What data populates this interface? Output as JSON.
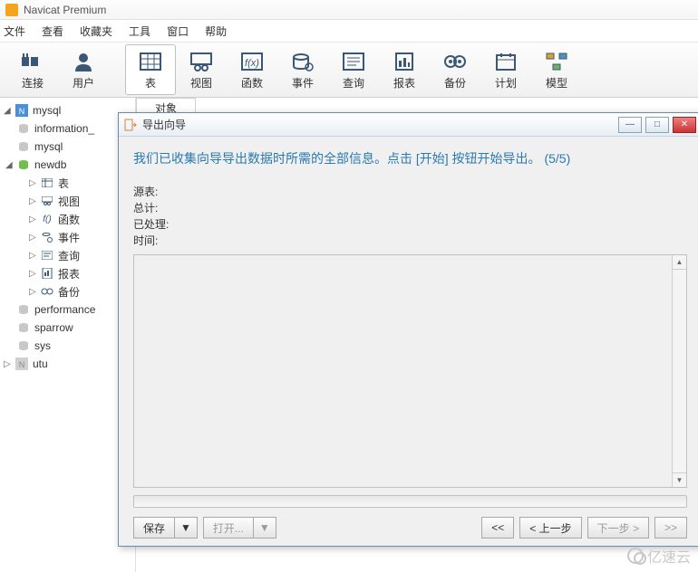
{
  "app": {
    "title": "Navicat Premium"
  },
  "menu": [
    "文件",
    "查看",
    "收藏夹",
    "工具",
    "窗口",
    "帮助"
  ],
  "toolbar": [
    {
      "label": "连接",
      "icon": "plug"
    },
    {
      "label": "用户",
      "icon": "user"
    },
    {
      "label": "表",
      "icon": "table",
      "active": true
    },
    {
      "label": "视图",
      "icon": "view"
    },
    {
      "label": "函数",
      "icon": "fx"
    },
    {
      "label": "事件",
      "icon": "event"
    },
    {
      "label": "查询",
      "icon": "query"
    },
    {
      "label": "报表",
      "icon": "report"
    },
    {
      "label": "备份",
      "icon": "backup"
    },
    {
      "label": "计划",
      "icon": "schedule"
    },
    {
      "label": "模型",
      "icon": "model"
    }
  ],
  "tree": {
    "root": "mysql",
    "children": [
      {
        "label": "information_",
        "type": "db"
      },
      {
        "label": "mysql",
        "type": "db"
      },
      {
        "label": "newdb",
        "type": "db",
        "expanded": true,
        "children": [
          {
            "label": "表",
            "icon": "table"
          },
          {
            "label": "视图",
            "icon": "view"
          },
          {
            "label": "函数",
            "icon": "fx"
          },
          {
            "label": "事件",
            "icon": "event"
          },
          {
            "label": "查询",
            "icon": "query"
          },
          {
            "label": "报表",
            "icon": "report"
          },
          {
            "label": "备份",
            "icon": "backup"
          }
        ]
      },
      {
        "label": "performance",
        "type": "db"
      },
      {
        "label": "sparrow",
        "type": "db"
      },
      {
        "label": "sys",
        "type": "db"
      }
    ],
    "other": "utu"
  },
  "tabstrip": {
    "tab1": "对象"
  },
  "dialog": {
    "title": "导出向导",
    "heading": "我们已收集向导导出数据时所需的全部信息。点击 [开始] 按钮开始导出。  (5/5)",
    "info": {
      "source": "源表:",
      "total": "总计:",
      "processed": "已处理:",
      "time": "时间:"
    },
    "buttons": {
      "save": "保存",
      "open": "打开...",
      "first": "<<",
      "prev": "< 上一步",
      "next": "下一步 >",
      "last": ">>"
    }
  },
  "watermark": "亿速云"
}
